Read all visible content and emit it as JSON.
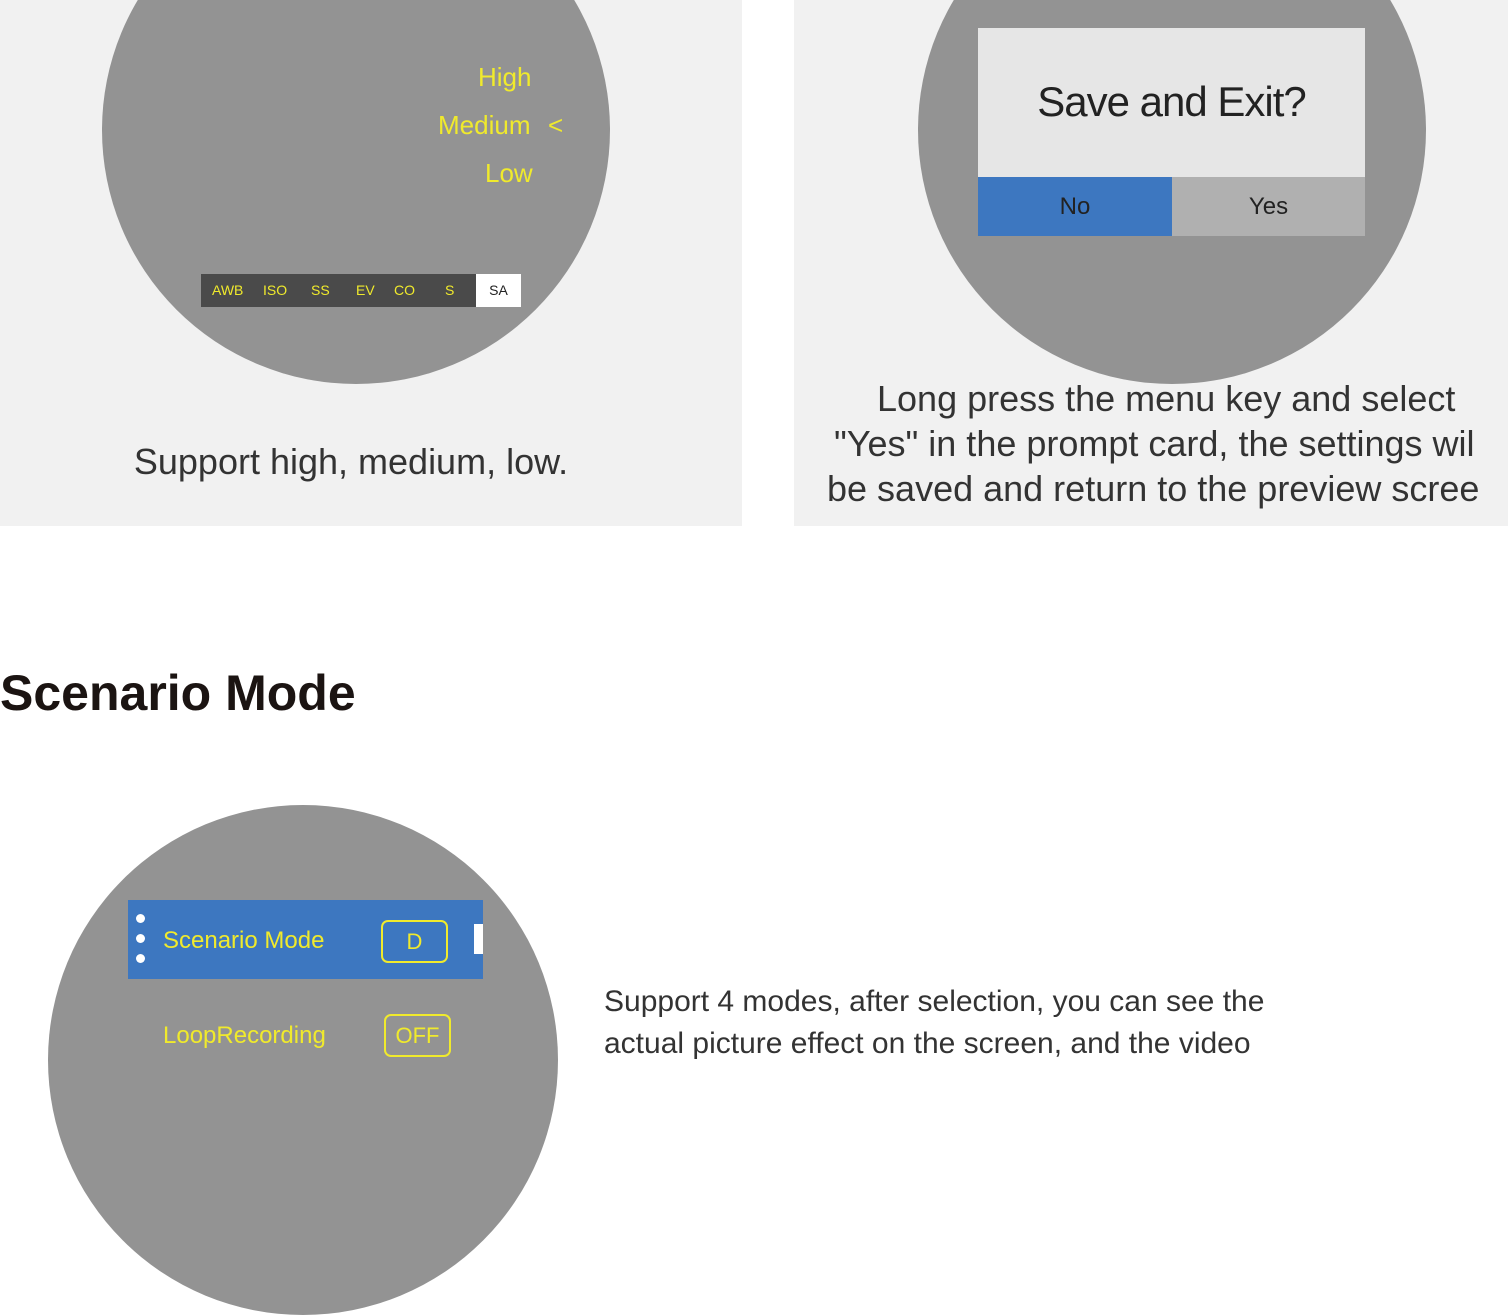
{
  "left_panel": {
    "levels": {
      "high": "High",
      "medium": "Medium",
      "low": "Low",
      "selected_marker": "<"
    },
    "toolbar": [
      "AWB",
      "ISO",
      "SS",
      "EV",
      "CO",
      "S"
    ],
    "toolbar_active": "SA",
    "caption": "Support high, medium, low."
  },
  "right_panel": {
    "dialog": {
      "title": "Save and Exit?",
      "no_label": "No",
      "yes_label": "Yes"
    },
    "caption_lines": [
      "Long press the menu key and select",
      "\"Yes\" in the prompt card, the settings wil",
      "be saved and return to the preview scree"
    ]
  },
  "section": {
    "title": "Scenario Mode",
    "menu": {
      "items": [
        {
          "label": "Scenario Mode",
          "value": "D"
        },
        {
          "label": "LoopRecording",
          "value": "OFF"
        }
      ]
    },
    "description_lines": [
      "Support 4 modes, after selection, you can see the",
      "actual picture effect on the screen, and the video"
    ]
  },
  "colors": {
    "panel_bg": "#f1f1f1",
    "circle": "#939393",
    "accent_yellow": "#f0ea2c",
    "selection_blue": "#3d77c0"
  }
}
